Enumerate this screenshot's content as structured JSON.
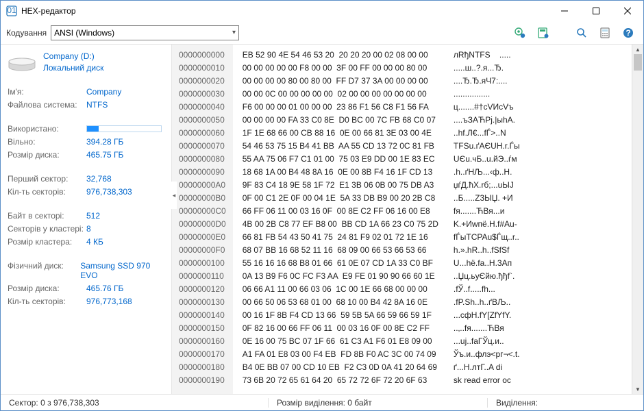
{
  "window": {
    "title": "HEX-редактор"
  },
  "toolbar": {
    "encoding_label": "Кодування",
    "encoding_value": "ANSI (Windows)"
  },
  "sidebar": {
    "drive_name": "Company (D:)",
    "drive_kind": "Локальний диск",
    "groups": [
      [
        {
          "k": "Ім'я:",
          "v": "Company"
        },
        {
          "k": "Файлова система:",
          "v": "NTFS"
        }
      ],
      [
        {
          "k": "Використано:",
          "bar": 0.16
        },
        {
          "k": "Вільно:",
          "v": "394.28 ГБ"
        },
        {
          "k": "Розмір диска:",
          "v": "465.75 ГБ"
        }
      ],
      [
        {
          "k": "Перший сектор:",
          "v": "32,768"
        },
        {
          "k": "Кіл-ть секторів:",
          "v": "976,738,303"
        }
      ],
      [
        {
          "k": "Байт в секторі:",
          "v": "512"
        },
        {
          "k": "Секторів у кластері:",
          "v": "8"
        },
        {
          "k": "Розмір кластера:",
          "v": "4 КБ"
        }
      ],
      [
        {
          "k": "Фізичний диск:",
          "v": "Samsung SSD 970 EVO"
        },
        {
          "k": "Розмір диска:",
          "v": "465.76 ГБ"
        },
        {
          "k": "Кіл-ть секторів:",
          "v": "976,773,168"
        }
      ]
    ]
  },
  "hex": {
    "rows": [
      {
        "o": "0000000000",
        "h": "EB 52 90 4E 54 46 53 20  20 20 20 00 02 08 00 00",
        "a": "лRђNTFS    ....."
      },
      {
        "o": "0000000010",
        "h": "00 00 00 00 00 F8 00 00  3F 00 FF 00 00 00 80 00",
        "a": ".....ш..?.я...Ђ."
      },
      {
        "o": "0000000020",
        "h": "00 00 00 00 80 00 80 00  FF D7 37 3A 00 00 00 00",
        "a": "....Ђ.Ђ.яЧ7:...."
      },
      {
        "o": "0000000030",
        "h": "00 00 0C 00 00 00 00 00  02 00 00 00 00 00 00 00",
        "a": "................"
      },
      {
        "o": "0000000040",
        "h": "F6 00 00 00 01 00 00 00  23 86 F1 56 C8 F1 56 FA",
        "a": "ц.......#†сVИсVъ"
      },
      {
        "o": "0000000050",
        "h": "00 00 00 00 FA 33 C0 8E  D0 BC 00 7C FB 68 C0 07",
        "a": "....ъЗАЋРј.|ыhА."
      },
      {
        "o": "0000000060",
        "h": "1F 1E 68 66 00 CB 88 16  0E 00 66 81 3E 03 00 4E",
        "a": "..hf.Л€...fЃ>..N"
      },
      {
        "o": "0000000070",
        "h": "54 46 53 75 15 B4 41 BB  AA 55 CD 13 72 0C 81 FB",
        "a": "TFSu.ґAЄUН.r.Ѓы"
      },
      {
        "o": "0000000080",
        "h": "55 AA 75 06 F7 C1 01 00  75 03 E9 DD 00 1E 83 EC",
        "a": "UЄu.чБ..u.йЭ..ѓм"
      },
      {
        "o": "0000000090",
        "h": "18 68 1A 00 B4 48 8A 16  0E 00 8B F4 16 1F CD 13",
        "a": ".h..ґHЉ...‹ф..Н."
      },
      {
        "o": "00000000A0",
        "h": "9F 83 C4 18 9E 58 1F 72  E1 3B 06 0B 00 75 DB A3",
        "a": "џѓД.ћX.rб;...uЫЈ"
      },
      {
        "o": "00000000B0",
        "h": "0F 00 C1 2E 0F 00 04 1E  5A 33 DB B9 00 20 2B C8",
        "a": "..Б.....Z3ЫЏ. +И"
      },
      {
        "o": "00000000C0",
        "h": "66 FF 06 11 00 03 16 0F  00 8E C2 FF 06 16 00 E8",
        "a": "fя.......ЋВя...и"
      },
      {
        "o": "00000000D0",
        "h": "4B 00 2B C8 77 EF B8 00  BB CD 1A 66 23 C0 75 2D",
        "a": "K.+Иwпё.Н.f#Аu-"
      },
      {
        "o": "00000000E0",
        "h": "66 81 FB 54 43 50 41 75  24 81 F9 02 01 72 1E 16",
        "a": "fЃыTCPAu$Ѓщ..r.."
      },
      {
        "o": "00000000F0",
        "h": "68 07 BB 16 68 52 11 16  68 09 00 66 53 66 53 66",
        "a": "h.».hR..h..fSfSf"
      },
      {
        "o": "0000000100",
        "h": "55 16 16 16 68 B8 01 66  61 0E 07 CD 1A 33 C0 BF",
        "a": "U...hё.fa..Н.3Ап"
      },
      {
        "o": "0000000110",
        "h": "0A 13 B9 F6 0C FC F3 AA  E9 FE 01 90 90 66 60 1E",
        "a": "..Џц.ьуЄйю.ђђf`."
      },
      {
        "o": "0000000120",
        "h": "06 66 A1 11 00 66 03 06  1C 00 1E 66 68 00 00 00",
        "a": ".fЎ..f.....fh..."
      },
      {
        "o": "0000000130",
        "h": "00 66 50 06 53 68 01 00  68 10 00 B4 42 8A 16 0E",
        "a": ".fP.Sh..h..ґBЉ.."
      },
      {
        "o": "0000000140",
        "h": "00 16 1F 8B F4 CD 13 66  59 5B 5A 66 59 66 59 1F",
        "a": "...ᴄфН.fY[ZfYfY."
      },
      {
        "o": "0000000150",
        "h": "0F 82 16 00 66 FF 06 11  00 03 16 0F 00 8E C2 FF",
        "a": "..‚..fя.......ЋВя"
      },
      {
        "o": "0000000160",
        "h": "0E 16 00 75 BC 07 1F 66  61 C3 A1 F6 01 E8 09 00",
        "a": "...uј..faГЎц.и.."
      },
      {
        "o": "0000000170",
        "h": "A1 FA 01 E8 03 00 F4 EB  FD 8B F0 AC 3C 00 74 09",
        "a": "Ўъ.и..флэ<pг¬<.t."
      },
      {
        "o": "0000000180",
        "h": "B4 0E BB 07 00 CD 10 EB  F2 C3 0D 0A 41 20 64 69",
        "a": "ґ...Н.лтГ..A di"
      },
      {
        "o": "0000000190",
        "h": "73 6B 20 72 65 61 64 20  65 72 72 6F 72 20 6F 63",
        "a": "sk read error oc"
      }
    ]
  },
  "status": {
    "sector": "Сектор: 0 з 976,738,303",
    "selection_size": "Розмір виділення: 0 байт",
    "selection": "Виділення:"
  },
  "colors": {
    "link": "#0066cc"
  }
}
